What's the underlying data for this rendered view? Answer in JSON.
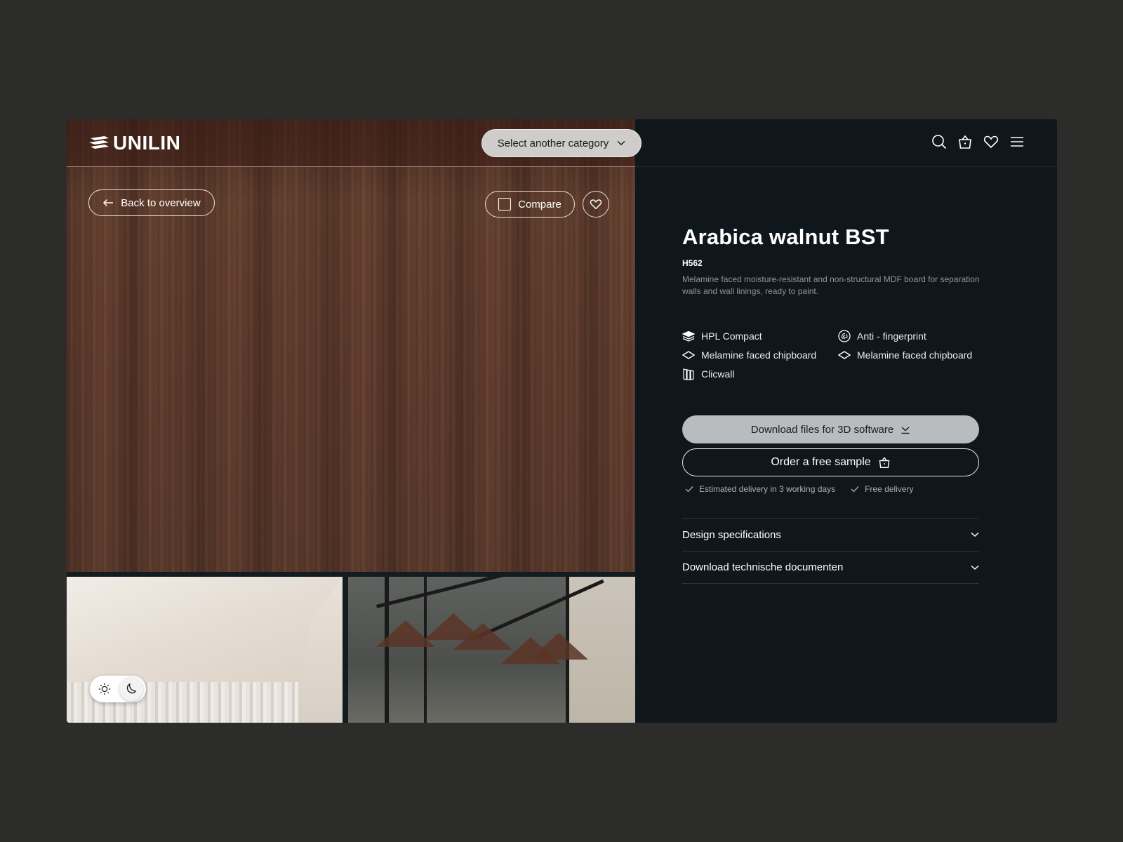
{
  "header": {
    "logo_text": "UNILIN",
    "category_select_label": "Select another category",
    "icons": [
      "search-icon",
      "basket-icon",
      "heart-icon",
      "menu-icon"
    ]
  },
  "media": {
    "back_label": "Back to overview",
    "compare_label": "Compare",
    "theme_toggle": {
      "light_icon": "sun-icon",
      "dark_icon": "moon-icon",
      "active": "dark"
    }
  },
  "product": {
    "title": "Arabica walnut BST",
    "code": "H562",
    "description": "Melamine faced moisture-resistant and non-structural MDF board for separation walls and wall linings, ready to paint.",
    "features": [
      {
        "label": "HPL Compact",
        "icon": "layers-icon"
      },
      {
        "label": "Anti - fingerprint",
        "icon": "fingerprint-icon"
      },
      {
        "label": "Melamine faced chipboard",
        "icon": "board-icon"
      },
      {
        "label": "Melamine faced chipboard",
        "icon": "board-icon"
      },
      {
        "label": "Clicwall",
        "icon": "wall-panels-icon"
      }
    ],
    "download_3d_label": "Download files for 3D software",
    "sample_label": "Order a free sample",
    "delivery_notes": [
      "Estimated delivery in 3 working days",
      "Free delivery"
    ],
    "accordion": [
      {
        "label": "Design specifications"
      },
      {
        "label": "Download technische documenten"
      }
    ]
  },
  "colors": {
    "page_bg": "#2c2c2a",
    "panel_bg": "#0f161c",
    "wood": "#5e3a2d",
    "primary_button": "#b9bcbf"
  }
}
